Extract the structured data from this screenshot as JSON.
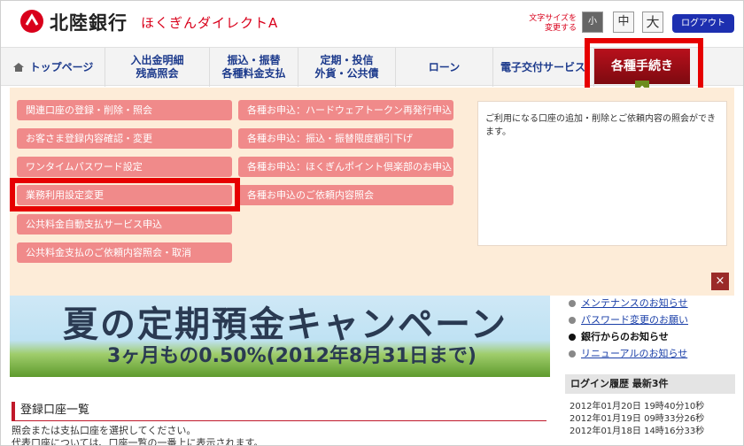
{
  "header": {
    "bank_name": "北陸銀行",
    "service_name": "ほくぎんダイレクトA",
    "font_size_label": "文字サイズを変更する",
    "font_small": "小",
    "font_mid": "中",
    "font_large": "大",
    "logout": "ログアウト"
  },
  "nav": {
    "home": "トップページ",
    "item1": "入出金明細\n残高照会",
    "item2": "振込・振替\n各種料金支払",
    "item3": "定期・投信\n外貨・公共債",
    "item4": "ローン",
    "item5": "電子交付サービス",
    "active": "各種手続き"
  },
  "menu": {
    "left": [
      "関連口座の登録・削除・照会",
      "お客さま登録内容確認・変更",
      "ワンタイムパスワード設定",
      "業務利用設定変更",
      "公共料金自動支払サービス申込",
      "公共料金支払のご依頼内容照会・取消"
    ],
    "right": [
      "各種お申込：ハードウェアトークン再発行申込",
      "各種お申込：振込・振替限度額引下げ",
      "各種お申込：ほくぎんポイント倶楽部のお申込",
      "各種お申込のご依頼内容照会"
    ],
    "description": "ご利用になる口座の追加・削除とご依頼内容の照会ができます。",
    "close": "×"
  },
  "banner": {
    "title": "夏の定期預金キャンペーン",
    "subtitle": "3ヶ月もの0.50%(2012年8月31日まで)"
  },
  "notices": [
    {
      "text": "メンテナンスのお知らせ",
      "bold": false
    },
    {
      "text": "パスワード変更のお願い",
      "bold": false
    },
    {
      "text": "銀行からのお知らせ",
      "bold": true
    },
    {
      "text": "リニューアルのお知らせ",
      "bold": false
    }
  ],
  "login_history": {
    "title": "ログイン履歴 最新3件",
    "rows": [
      "2012年01月20日 19時40分10秒",
      "2012年01月19日 09時33分26秒",
      "2012年01月18日 14時16分33秒"
    ]
  },
  "accounts": {
    "title": "登録口座一覧",
    "line1": "照会または支払口座を選択してください。",
    "line2": "代表口座については、口座一覧の一番上に表示されます。"
  },
  "colors": {
    "brand_red": "#d9001b",
    "menu_button": "#f08a8a",
    "dropdown_bg": "#fdecd8",
    "nav_text": "#1c3a8c",
    "highlight": "#e60000"
  }
}
